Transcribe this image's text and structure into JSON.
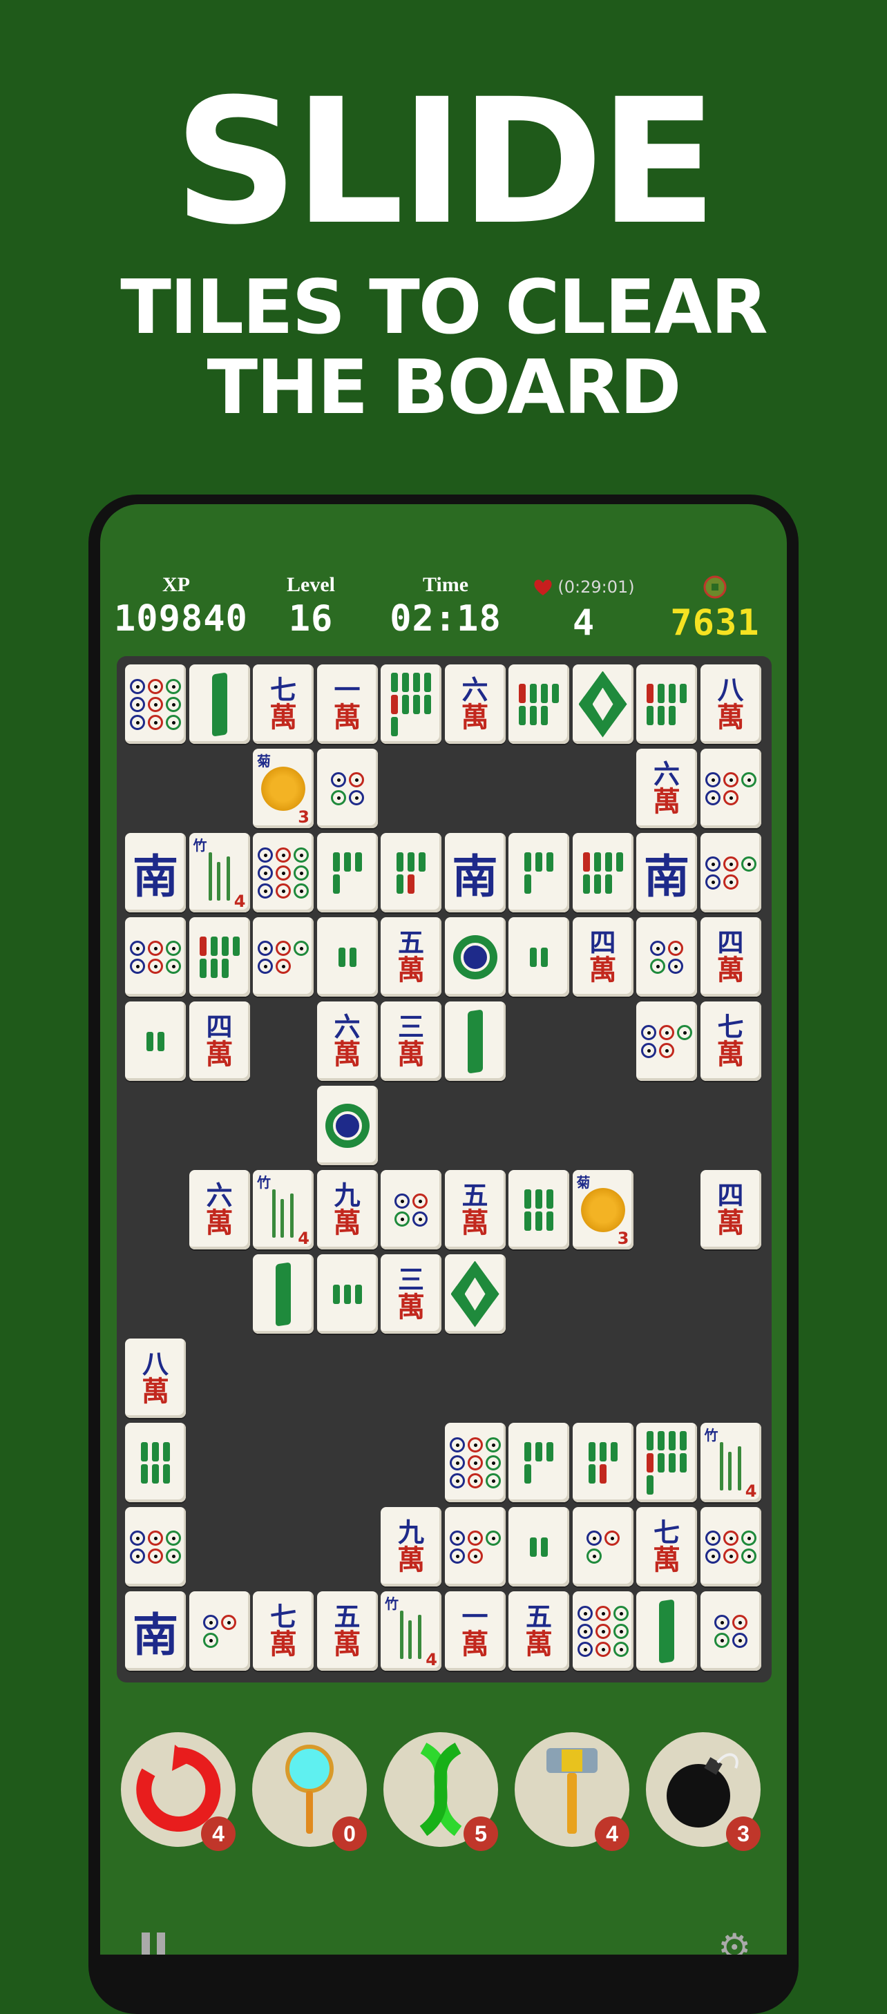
{
  "headline": {
    "title": "SLIDE",
    "line1": "TILES TO CLEAR",
    "line2": "THE BOARD"
  },
  "hud": {
    "xp_label": "XP",
    "xp_value": "109840",
    "level_label": "Level",
    "level_value": "16",
    "time_label": "Time",
    "time_value": "02:18",
    "lives_timer": "(0:29:01)",
    "lives_value": "4",
    "coins_value": "7631"
  },
  "tiles": {
    "wan_char": "萬",
    "wind_south": "南",
    "n1": "一",
    "n3": "三",
    "n4": "四",
    "n5": "五",
    "n6": "六",
    "n7": "七",
    "n8": "八",
    "n9": "九",
    "flower_corner": "菊",
    "bamboo_corner": "竹",
    "flower_num": "3",
    "bamboo_num": "4"
  },
  "toolbar": {
    "undo_count": "4",
    "magnifier_count": "0",
    "shuffle_count": "5",
    "hammer_count": "4",
    "bomb_count": "3"
  },
  "colors": {
    "background": "#1f5a1a",
    "screen_green": "#2b6b22",
    "board": "#363636",
    "coin_yellow": "#f5e222",
    "badge_red": "#c0362a"
  }
}
